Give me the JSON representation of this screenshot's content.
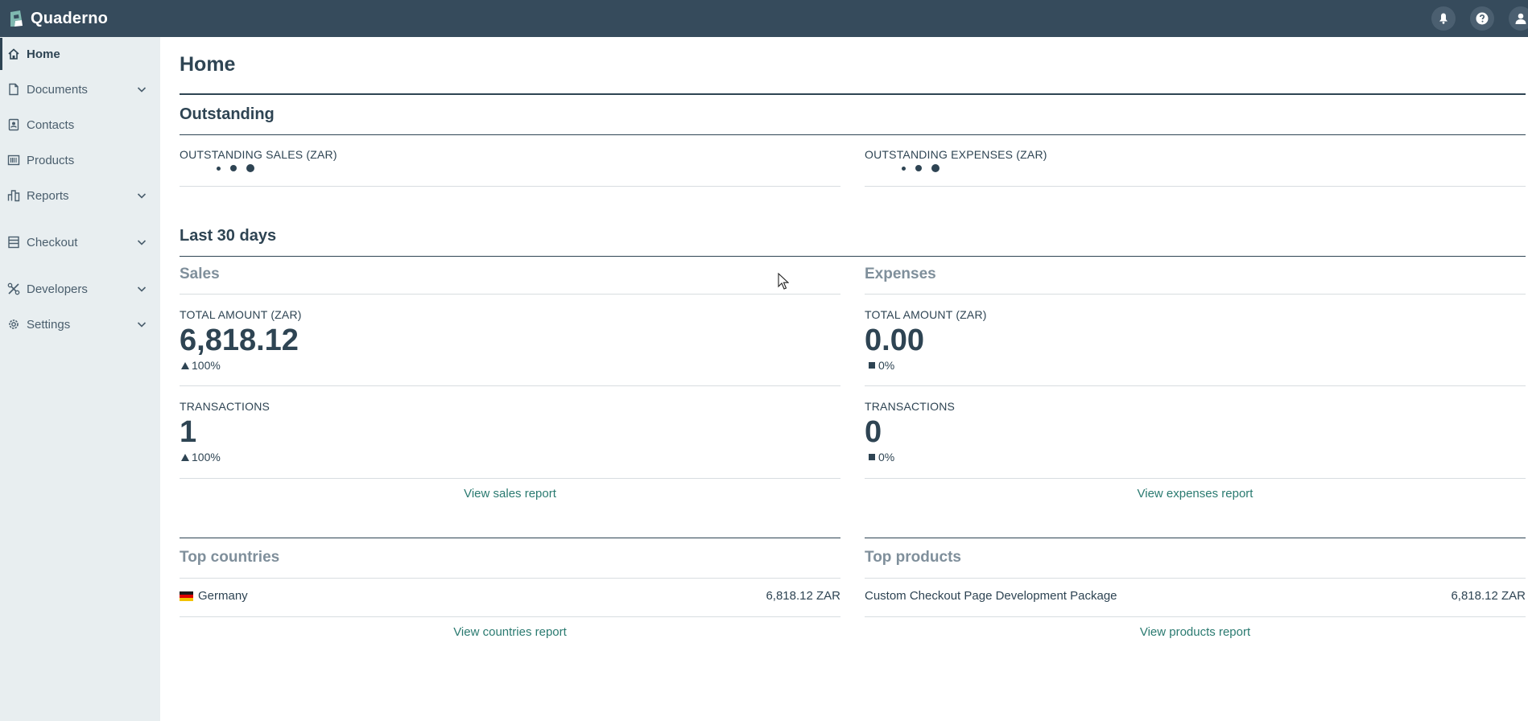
{
  "app": {
    "name": "Quaderno"
  },
  "topbar": {
    "icons": [
      "bell-icon",
      "help-icon",
      "user-icon"
    ]
  },
  "sidebar": {
    "items": [
      {
        "label": "Home",
        "icon": "home-icon",
        "active": true,
        "expandable": false
      },
      {
        "label": "Documents",
        "icon": "document-icon",
        "active": false,
        "expandable": true
      },
      {
        "label": "Contacts",
        "icon": "contacts-icon",
        "active": false,
        "expandable": false
      },
      {
        "label": "Products",
        "icon": "barcode-icon",
        "active": false,
        "expandable": false
      },
      {
        "label": "Reports",
        "icon": "reports-icon",
        "active": false,
        "expandable": true
      },
      {
        "label": "Checkout",
        "icon": "checkout-icon",
        "active": false,
        "expandable": true
      },
      {
        "label": "Developers",
        "icon": "tools-icon",
        "active": false,
        "expandable": true
      },
      {
        "label": "Settings",
        "icon": "gear-icon",
        "active": false,
        "expandable": true
      }
    ]
  },
  "page": {
    "title": "Home"
  },
  "outstanding": {
    "title": "Outstanding",
    "sales_label": "OUTSTANDING SALES (ZAR)",
    "expenses_label": "OUTSTANDING EXPENSES (ZAR)"
  },
  "last30": {
    "title": "Last 30 days",
    "sales": {
      "title": "Sales",
      "total_label": "TOTAL AMOUNT (ZAR)",
      "total_value": "6,818.12",
      "total_delta": "100%",
      "transactions_label": "TRANSACTIONS",
      "transactions_value": "1",
      "transactions_delta": "100%",
      "report_link": "View sales report"
    },
    "expenses": {
      "title": "Expenses",
      "total_label": "TOTAL AMOUNT (ZAR)",
      "total_value": "0.00",
      "total_delta": "0%",
      "transactions_label": "TRANSACTIONS",
      "transactions_value": "0",
      "transactions_delta": "0%",
      "report_link": "View expenses report"
    }
  },
  "top_countries": {
    "title": "Top countries",
    "rows": [
      {
        "country": "Germany",
        "amount": "6,818.12 ZAR"
      }
    ],
    "report_link": "View countries report"
  },
  "top_products": {
    "title": "Top products",
    "rows": [
      {
        "product": "Custom Checkout Page Development Package",
        "amount": "6,818.12 ZAR"
      }
    ],
    "report_link": "View products report"
  },
  "colors": {
    "topbar": "#364b5c",
    "sidebar": "#e8eef0",
    "text": "#2e4453",
    "link": "#2a7a70",
    "muted": "#7f8f9b"
  }
}
